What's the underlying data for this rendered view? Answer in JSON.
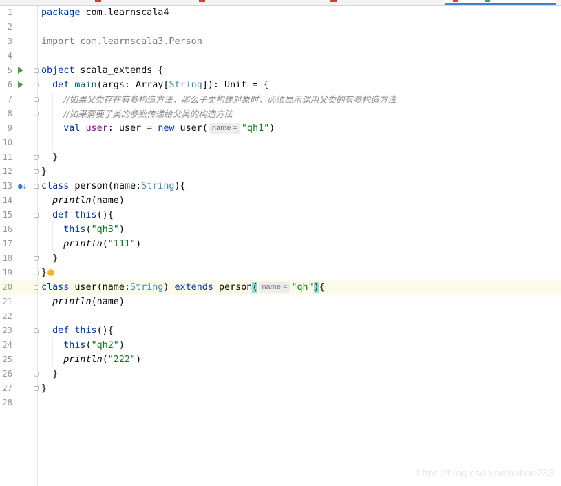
{
  "watermark": "https://blog.csdn.net/qihoo233",
  "code": {
    "l1": {
      "kw": "package",
      "rest": " com.learnscala4"
    },
    "l3": {
      "text": "import com.learnscala3.Person"
    },
    "l5": {
      "kw": "object",
      "rest": " scala_extends {"
    },
    "l6": {
      "kw1": "def",
      "fn": "main",
      "p1": "(args: Array[",
      "cls": "String",
      "p2": "]): Unit = {"
    },
    "l7": {
      "comment": "//如果父类存在有参构造方法，那么子类构建对象时，必须显示调用父类的有参构造方法"
    },
    "l8": {
      "comment": "//如果需要子类的参数传递给父类的构造方法"
    },
    "l9": {
      "kw1": "val",
      "var": "user",
      "p1": ": user = ",
      "kw2": "new",
      "p2": " user(",
      "hint": "name =",
      "str": "\"qh1\"",
      "p3": ")"
    },
    "l11": {
      "text": "}"
    },
    "l12": {
      "text": "}"
    },
    "l13": {
      "kw": "class",
      "p1": " person(name:",
      "cls": "String",
      "p2": "){"
    },
    "l14": {
      "fn": "println",
      "p1": "(name)"
    },
    "l15": {
      "kw1": "def",
      "kw2": "this",
      "p1": "(){"
    },
    "l16": {
      "kw": "this",
      "p1": "(",
      "str": "\"qh3\"",
      "p2": ")"
    },
    "l17": {
      "fn": "println",
      "p1": "(",
      "str": "\"111\"",
      "p2": ")"
    },
    "l18": {
      "text": "}"
    },
    "l19": {
      "text": "}"
    },
    "l20": {
      "kw": "class",
      "p1": " user(name:",
      "cls": "String",
      "p2": ") ",
      "kw2": "extends",
      "p3": " person",
      "open": "(",
      "hint": "name =",
      "str": "\"qh\"",
      "close": ")",
      "p4": "{"
    },
    "l21": {
      "fn": "println",
      "p1": "(name)"
    },
    "l23": {
      "kw1": "def",
      "kw2": "this",
      "p1": "(){"
    },
    "l24": {
      "kw": "this",
      "p1": "(",
      "str": "\"qh2\"",
      "p2": ")"
    },
    "l25": {
      "fn": "println",
      "p1": "(",
      "str": "\"222\"",
      "p2": ")"
    },
    "l26": {
      "text": "}"
    },
    "l27": {
      "text": "}"
    }
  },
  "line_numbers": [
    "1",
    "2",
    "3",
    "4",
    "5",
    "6",
    "7",
    "8",
    "9",
    "10",
    "11",
    "12",
    "13",
    "14",
    "15",
    "16",
    "17",
    "18",
    "19",
    "20",
    "21",
    "22",
    "23",
    "24",
    "25",
    "26",
    "27",
    "28"
  ],
  "colors": {
    "keyword": "#0033b3",
    "string": "#067d17",
    "comment": "#8c8c8c",
    "current_line": "#fcfae9",
    "run_icon": "#4a9a4a"
  }
}
